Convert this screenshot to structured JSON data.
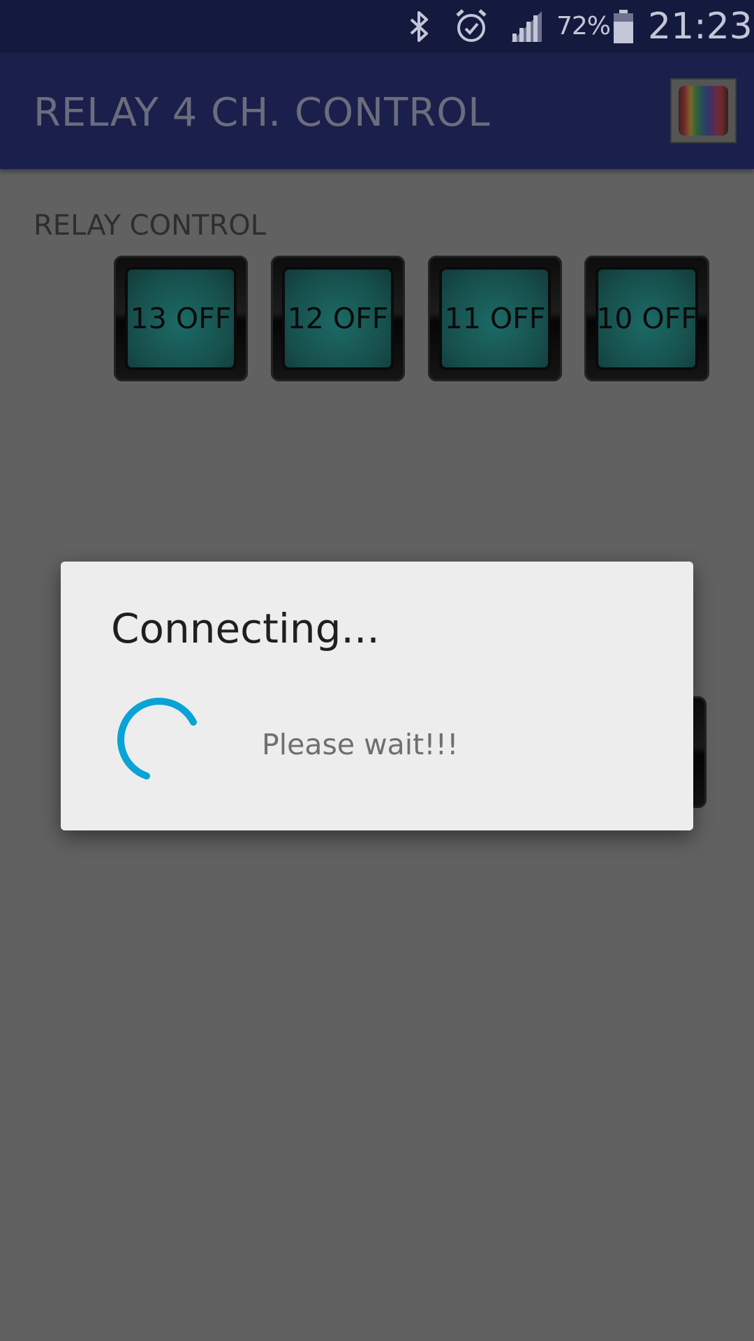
{
  "status_bar": {
    "battery_percent": "72%",
    "time": "21:23",
    "icons": [
      "bluetooth-icon",
      "alarm-icon",
      "signal-icon",
      "battery-icon"
    ]
  },
  "app_bar": {
    "title": "RELAY 4 CH. CONTROL",
    "logo_icon": "rainbow-logo-icon"
  },
  "content": {
    "section_label": "RELAY CONTROL",
    "relays": [
      {
        "label": "13 OFF"
      },
      {
        "label": "12 OFF"
      },
      {
        "label": "11 OFF"
      },
      {
        "label": "10 OFF"
      }
    ]
  },
  "dialog": {
    "title": "Connecting...",
    "message": "Please wait!!!",
    "spinner_icon": "progress-spinner-icon"
  },
  "colors": {
    "status_bar": "#141a3e",
    "app_bar": "#1a1f4b",
    "scrim_background": "#616161",
    "dialog_background": "#ededed",
    "spinner_accent": "#0aa3d6"
  }
}
